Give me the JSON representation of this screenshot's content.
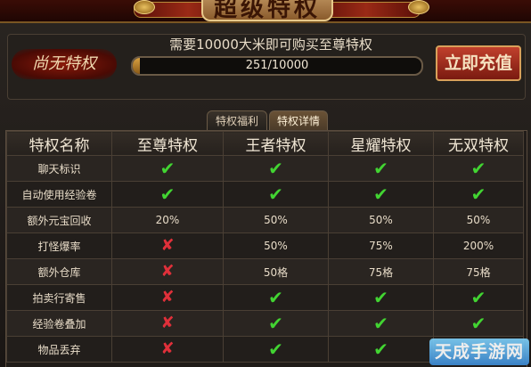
{
  "banner": {
    "title": "超级特权"
  },
  "header": {
    "vip_status": "尚无特权",
    "requirement": "需要10000大米即可购买至尊特权",
    "progress_text": "251/10000",
    "progress_fraction": 0.0251,
    "recharge_label": "立即充值"
  },
  "tabs": {
    "benefits": "特权福利",
    "details": "特权详情"
  },
  "table": {
    "headers": {
      "name": "特权名称",
      "t1": "至尊特权",
      "t2": "王者特权",
      "t3": "星耀特权",
      "t4": "无双特权"
    },
    "rows": [
      {
        "name": "聊天标识",
        "c1": "check",
        "c2": "check",
        "c3": "check",
        "c4": "check"
      },
      {
        "name": "自动使用经验卷",
        "c1": "check",
        "c2": "check",
        "c3": "check",
        "c4": "check"
      },
      {
        "name": "额外元宝回收",
        "c1": "20%",
        "c2": "50%",
        "c3": "50%",
        "c4": "50%"
      },
      {
        "name": "打怪爆率",
        "c1": "cross",
        "c2": "50%",
        "c3": "75%",
        "c4": "200%"
      },
      {
        "name": "额外仓库",
        "c1": "cross",
        "c2": "50格",
        "c3": "75格",
        "c4": "75格"
      },
      {
        "name": "拍卖行寄售",
        "c1": "cross",
        "c2": "check",
        "c3": "check",
        "c4": "check"
      },
      {
        "name": "经验卷叠加",
        "c1": "cross",
        "c2": "check",
        "c3": "check",
        "c4": "check"
      },
      {
        "name": "物品丢弃",
        "c1": "cross",
        "c2": "check",
        "c3": "check",
        "c4": "check"
      }
    ],
    "icons": {
      "check": "✔",
      "cross": "✘"
    }
  },
  "watermark": "天成手游网",
  "colors": {
    "check": "#42d432",
    "cross": "#e0303a",
    "accent": "#c0402c"
  }
}
